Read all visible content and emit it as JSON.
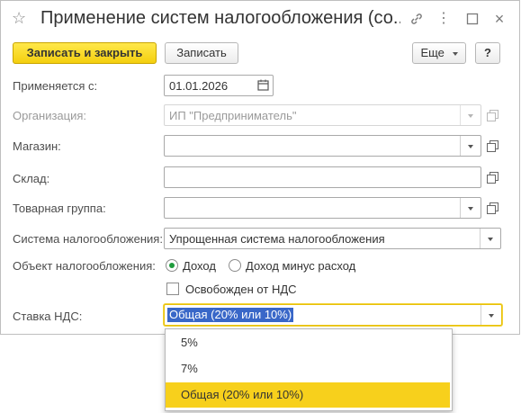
{
  "window": {
    "title": "Применение систем налогообложения (со...",
    "icons": [
      "star-icon",
      "link-icon",
      "more-icon",
      "restore-icon",
      "close-icon"
    ]
  },
  "toolbar": {
    "save_close_label": "Записать и закрыть",
    "save_label": "Записать",
    "more_label": "Еще",
    "help_label": "?"
  },
  "form": {
    "applies_from": {
      "label": "Применяется с:",
      "value": "01.01.2026"
    },
    "organization": {
      "label": "Организация:",
      "value": "ИП \"Предприниматель\""
    },
    "store": {
      "label": "Магазин:",
      "value": ""
    },
    "warehouse": {
      "label": "Склад:",
      "value": ""
    },
    "product_group": {
      "label": "Товарная группа:",
      "value": ""
    },
    "tax_system": {
      "label": "Система налогообложения:",
      "value": "Упрощенная система налогообложения"
    },
    "tax_object": {
      "label": "Объект налогообложения:",
      "options": [
        "Доход",
        "Доход минус расход"
      ],
      "selected": "Доход"
    },
    "vat_exempt": {
      "label": "Освобожден от НДС",
      "checked": false
    },
    "vat_rate": {
      "label": "Ставка НДС:",
      "value": "Общая (20% или 10%)"
    }
  },
  "dropdown": {
    "options": [
      "5%",
      "7%",
      "Общая (20% или 10%)"
    ],
    "selected": "Общая (20% или 10%)"
  },
  "colors": {
    "primary_button": "#f4cf0f",
    "radio_selected": "#1f9c3d",
    "selection_highlight": "#3967c8",
    "dropdown_selected": "#f7d01c",
    "focus_border": "#e8c10a"
  }
}
